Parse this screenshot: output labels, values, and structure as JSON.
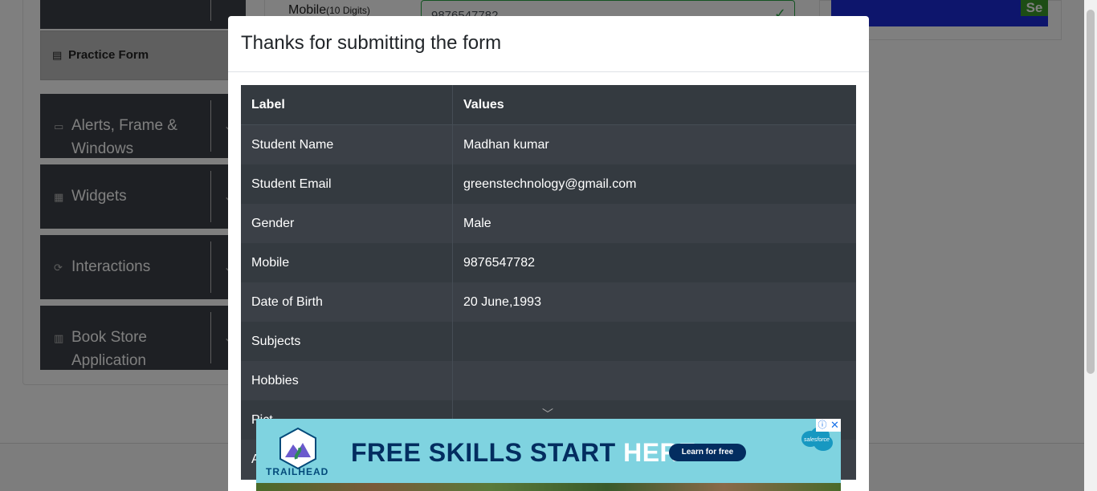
{
  "background": {
    "sidebar": {
      "practice_form": "Practice Form",
      "groups": [
        {
          "label": "Alerts, Frame & Windows",
          "icon": "window-icon"
        },
        {
          "label": "Widgets",
          "icon": "widgets-icon"
        },
        {
          "label": "Interactions",
          "icon": "interactions-icon"
        },
        {
          "label": "Book Store Application",
          "icon": "books-icon"
        }
      ]
    },
    "mobile_label": "Mobile",
    "mobile_hint": "(10 Digits)",
    "mobile_value": "9876547782",
    "ad_badge": "Se"
  },
  "modal": {
    "title": "Thanks for submitting the form",
    "table": {
      "headers": [
        "Label",
        "Values"
      ],
      "rows": [
        {
          "label": "Student Name",
          "value": "Madhan kumar"
        },
        {
          "label": "Student Email",
          "value": "greenstechnology@gmail.com"
        },
        {
          "label": "Gender",
          "value": "Male"
        },
        {
          "label": "Mobile",
          "value": "9876547782"
        },
        {
          "label": "Date of Birth",
          "value": "20 June,1993"
        },
        {
          "label": "Subjects",
          "value": ""
        },
        {
          "label": "Hobbies",
          "value": ""
        },
        {
          "label": "Pict",
          "value": ""
        },
        {
          "label": "A",
          "value": ""
        }
      ]
    }
  },
  "ad": {
    "brand": "TRAILHEAD",
    "headline_dark": "FREE SKILLS START",
    "headline_light": "HERE.",
    "cta": "Learn for free",
    "partner": "salesforce",
    "colors": {
      "background": "#7fd3e0",
      "navy": "#032d60"
    }
  }
}
